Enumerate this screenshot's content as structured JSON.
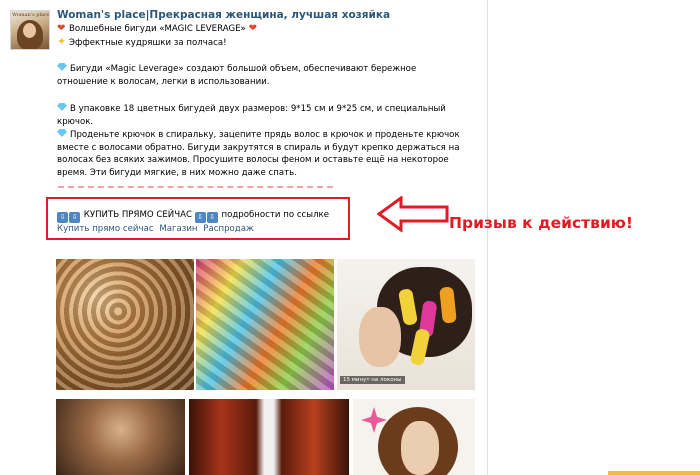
{
  "post": {
    "avatar_caption": "Woman's place",
    "title": "Woman's place|Прекрасная женщина, лучшая хозяйка",
    "lines": [
      "Волшебные бигуди «MAGIC LEVERAGE»",
      "Эффектные кудряшки за полчаса!"
    ],
    "paragraphs": [
      "Бигуди «Magic Leverage» создают большой объем, обеспечивают бережное отношение к волосам, легки в использовании.",
      "В упаковке 18 цветных бигудей двух размеров: 9*15 см и 9*25 см, и специальный крючок.",
      "Проденьте крючок в спиральку, зацепите прядь волос в крючок и проденьте крючок вместе с волосами обратно. Бигуди закрутятся в спираль и будут крепко держаться на волосах без всяких зажимов. Просушите волосы феном и оставьте ещё на некоторое время. Эти бигуди мягкие, в них можно даже спать."
    ],
    "cta": {
      "buy_now": "КУПИТЬ ПРЯМО СЕЙЧАС",
      "details": "подробности по ссылке",
      "links": [
        "Купить прямо сейчас",
        "Магазин",
        "Распродаж"
      ]
    },
    "photo_caption": "15 минут на локоны"
  },
  "annotation": {
    "callout": "Призыв к действию!",
    "color": "#e11b24"
  },
  "colors": {
    "link": "#2b587a",
    "heart": "#e2472f",
    "diamond": "#6bc7ef"
  },
  "icons": [
    "avatar",
    "heart-icon",
    "sparkle-icon",
    "diamond-icon",
    "arrow-down-icon",
    "callout-arrow"
  ]
}
